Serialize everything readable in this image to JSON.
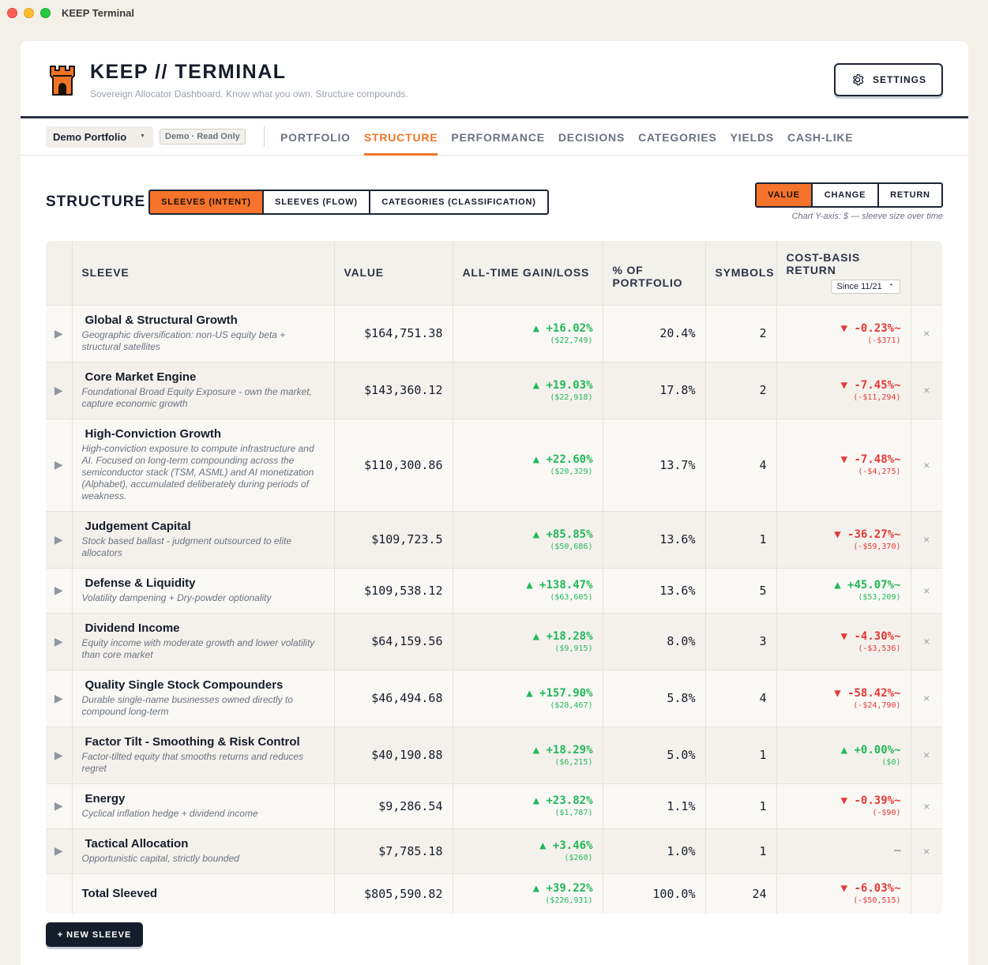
{
  "window": {
    "title": "KEEP Terminal"
  },
  "header": {
    "brand": "KEEP // TERMINAL",
    "tagline": "Sovereign Allocator Dashboard. Know what you own. Structure compounds.",
    "settings_label": "SETTINGS",
    "logo_color": "#f07427"
  },
  "nav": {
    "portfolio_selected": "Demo Portfolio",
    "demo_badge": "Demo · Read Only",
    "tabs": [
      {
        "label": "PORTFOLIO",
        "active": false
      },
      {
        "label": "STRUCTURE",
        "active": true
      },
      {
        "label": "PERFORMANCE",
        "active": false
      },
      {
        "label": "DECISIONS",
        "active": false
      },
      {
        "label": "CATEGORIES",
        "active": false
      },
      {
        "label": "YIELDS",
        "active": false
      },
      {
        "label": "CASH-LIKE",
        "active": false
      }
    ]
  },
  "structure": {
    "title": "STRUCTURE",
    "views": [
      {
        "label": "SLEEVES (INTENT)",
        "active": true
      },
      {
        "label": "SLEEVES (FLOW)",
        "active": false
      },
      {
        "label": "CATEGORIES (CLASSIFICATION)",
        "active": false
      }
    ],
    "metrics": [
      {
        "label": "VALUE",
        "active": true
      },
      {
        "label": "CHANGE",
        "active": false
      },
      {
        "label": "RETURN",
        "active": false
      }
    ],
    "axis_note": "Chart Y-axis: $ — sleeve size over time"
  },
  "table": {
    "headers": {
      "sleeve": "SLEEVE",
      "value": "VALUE",
      "gain": "ALL-TIME GAIN/LOSS",
      "pct": "% OF PORTFOLIO",
      "symbols": "SYMBOLS",
      "cbr": "COST-BASIS RETURN",
      "since": "Since 11/21"
    },
    "rows": [
      {
        "name": "Global & Structural Growth",
        "desc": "Geographic diversification: non-US equity beta + structural satellites",
        "value": "$164,751.38",
        "gain_pct": "▲ +16.02%",
        "gain_amt": "($22,749)",
        "pct": "20.4%",
        "symbols": "2",
        "cbr_pct": "▼ -0.23%~",
        "cbr_amt": "(-$371)"
      },
      {
        "name": "Core Market Engine",
        "desc": "Foundational Broad Equity Exposure - own the market, capture economic growth",
        "value": "$143,360.12",
        "gain_pct": "▲ +19.03%",
        "gain_amt": "($22,918)",
        "pct": "17.8%",
        "symbols": "2",
        "cbr_pct": "▼ -7.45%~",
        "cbr_amt": "(-$11,294)"
      },
      {
        "name": "High-Conviction Growth",
        "desc": "High-conviction exposure to compute infrastructure and AI. Focused on long-term compounding across the semiconductor stack (TSM, ASML) and AI monetization (Alphabet), accumulated deliberately during periods of weakness.",
        "value": "$110,300.86",
        "gain_pct": "▲ +22.60%",
        "gain_amt": "($20,329)",
        "pct": "13.7%",
        "symbols": "4",
        "cbr_pct": "▼ -7.48%~",
        "cbr_amt": "(-$4,275)"
      },
      {
        "name": "Judgement Capital",
        "desc": "Stock based ballast - judgment outsourced to elite allocators",
        "value": "$109,723.5",
        "gain_pct": "▲ +85.85%",
        "gain_amt": "($50,686)",
        "pct": "13.6%",
        "symbols": "1",
        "cbr_pct": "▼ -36.27%~",
        "cbr_amt": "(-$59,370)"
      },
      {
        "name": "Defense & Liquidity",
        "desc": "Volatility dampening + Dry-powder optionality",
        "value": "$109,538.12",
        "gain_pct": "▲ +138.47%",
        "gain_amt": "($63,605)",
        "pct": "13.6%",
        "symbols": "5",
        "cbr_pct": "▲ +45.07%~",
        "cbr_amt": "($53,209)"
      },
      {
        "name": "Dividend Income",
        "desc": "Equity income with moderate growth and lower volatility than core market",
        "value": "$64,159.56",
        "gain_pct": "▲ +18.28%",
        "gain_amt": "($9,915)",
        "pct": "8.0%",
        "symbols": "3",
        "cbr_pct": "▼ -4.30%~",
        "cbr_amt": "(-$3,536)"
      },
      {
        "name": "Quality Single Stock Compounders",
        "desc": "Durable single-name businesses owned directly to compound long-term",
        "value": "$46,494.68",
        "gain_pct": "▲ +157.90%",
        "gain_amt": "($28,467)",
        "pct": "5.8%",
        "symbols": "4",
        "cbr_pct": "▼ -58.42%~",
        "cbr_amt": "(-$24,790)"
      },
      {
        "name": "Factor Tilt - Smoothing & Risk Control",
        "desc": "Factor-tilted equity that smooths returns and reduces regret",
        "value": "$40,190.88",
        "gain_pct": "▲ +18.29%",
        "gain_amt": "($6,215)",
        "pct": "5.0%",
        "symbols": "1",
        "cbr_pct": "▲ +0.00%~",
        "cbr_amt": "($0)"
      },
      {
        "name": "Energy",
        "desc": "Cyclical inflation hedge + dividend income",
        "value": "$9,286.54",
        "gain_pct": "▲ +23.82%",
        "gain_amt": "($1,787)",
        "pct": "1.1%",
        "symbols": "1",
        "cbr_pct": "▼ -0.39%~",
        "cbr_amt": "(-$90)"
      },
      {
        "name": "Tactical Allocation",
        "desc": "Opportunistic capital, strictly bounded",
        "value": "$7,785.18",
        "gain_pct": "▲ +3.46%",
        "gain_amt": "($260)",
        "pct": "1.0%",
        "symbols": "1",
        "cbr_pct": "—",
        "cbr_amt": ""
      }
    ],
    "total": {
      "label": "Total Sleeved",
      "value": "$805,590.82",
      "gain_pct": "▲ +39.22%",
      "gain_amt": "($226,931)",
      "pct": "100.0%",
      "symbols": "24",
      "cbr_pct": "▼ -6.03%~",
      "cbr_amt": "(-$50,515)"
    }
  },
  "new_sleeve_label": "+ NEW SLEEVE",
  "colors": {
    "accent": "#f07427",
    "positive": "#22b85a",
    "negative": "#e53935",
    "dark": "#151c2b"
  }
}
